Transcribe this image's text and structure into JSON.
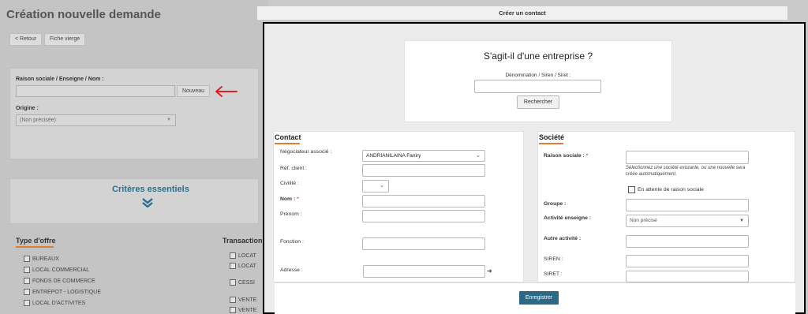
{
  "background": {
    "title": "Création nouvelle demande",
    "buttons": {
      "back": "< Retour",
      "blank": "Fiche vierge"
    },
    "fields": {
      "raison_label": "Raison sociale / Enseigne / Nom :",
      "nouveau": "Nouveau",
      "origine_label": "Origine :",
      "origine_value": "(Non précisée)"
    },
    "criteria_title": "Critères essentiels",
    "offer": {
      "heading": "Type d'offre",
      "items": [
        "BUREAUX",
        "LOCAL COMMERCIAL",
        "FONDS DE COMMERCE",
        "ENTREPOT - LOGISTIQUE",
        "LOCAL D'ACTIVITES"
      ]
    },
    "transaction": {
      "heading": "Transaction",
      "items": [
        "LOCAT",
        "LOCAT",
        "CESSI",
        "VENTE",
        "VENTE"
      ]
    }
  },
  "modal": {
    "title": "Créer un contact",
    "question": "S'agit-il d'une entreprise ?",
    "search_label": "Dénomination / Siren / Siret :",
    "search_button": "Rechercher",
    "contact": {
      "heading": "Contact",
      "negociateur_label": "Négociateur associé :",
      "negociateur_value": "ANDRIANILAINA Faniry",
      "ref_label": "Réf. client :",
      "civilite_label": "Civilité :",
      "nom_label": "Nom :",
      "prenom_label": "Prénom :",
      "fonction_label": "Fonction :",
      "adresse_label": "Adresse :"
    },
    "societe": {
      "heading": "Société",
      "raison_label": "Raison sociale :",
      "note": "Sélectionnez une société existante, ou une nouvelle sera créée automatiquement.",
      "attente_label": "En attente de raison sociale",
      "groupe_label": "Groupe :",
      "activite_label": "Activité enseigne :",
      "activite_value": "Non précisé",
      "autre_label": "Autre activité :",
      "siren_label": "SIREN :",
      "siret_label": "SIRET :"
    },
    "save_button": "Enregistrer"
  },
  "colors": {
    "accent": "#2b6a87",
    "underline": "#e07b39",
    "arrow": "#e02020",
    "required": "#d9534f"
  }
}
